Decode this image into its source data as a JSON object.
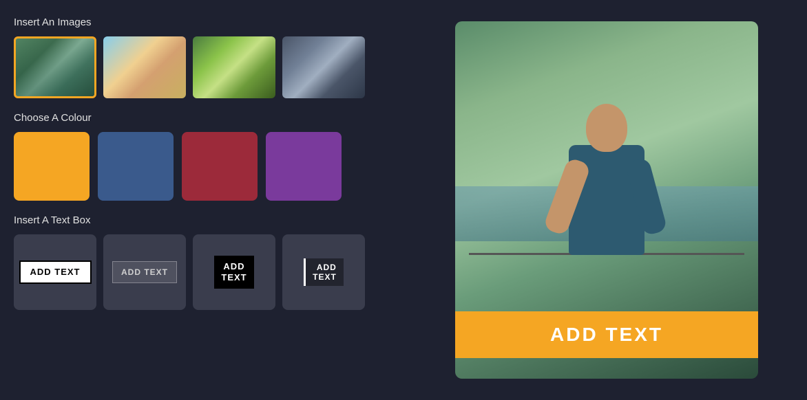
{
  "leftPanel": {
    "insertImages": {
      "title": "Insert An Images",
      "images": [
        {
          "id": "img-runner",
          "label": "Runner image",
          "selected": true
        },
        {
          "id": "img-beach",
          "label": "Beach image",
          "selected": false
        },
        {
          "id": "img-salad",
          "label": "Salad image",
          "selected": false
        },
        {
          "id": "img-building",
          "label": "Building image",
          "selected": false
        }
      ]
    },
    "chooseColour": {
      "title": "Choose A Colour",
      "colours": [
        {
          "id": "orange",
          "hex": "#f5a623",
          "label": "Orange"
        },
        {
          "id": "blue",
          "hex": "#3a5a8c",
          "label": "Blue"
        },
        {
          "id": "red",
          "hex": "#9c2a3a",
          "label": "Red"
        },
        {
          "id": "purple",
          "hex": "#7a3a9c",
          "label": "Purple"
        }
      ]
    },
    "insertTextBox": {
      "title": "Insert A Text Box",
      "options": [
        {
          "id": "tb1",
          "style": "1",
          "line1": "ADD TEXT",
          "line2": ""
        },
        {
          "id": "tb2",
          "style": "2",
          "line1": "ADD TEXT",
          "line2": ""
        },
        {
          "id": "tb3",
          "style": "3",
          "line1": "ADD",
          "line2": "TEXT"
        },
        {
          "id": "tb4",
          "style": "4",
          "line1": "ADD",
          "line2": "TEXT"
        }
      ]
    }
  },
  "rightPanel": {
    "preview": {
      "bannerText": "ADD TEXT"
    }
  }
}
